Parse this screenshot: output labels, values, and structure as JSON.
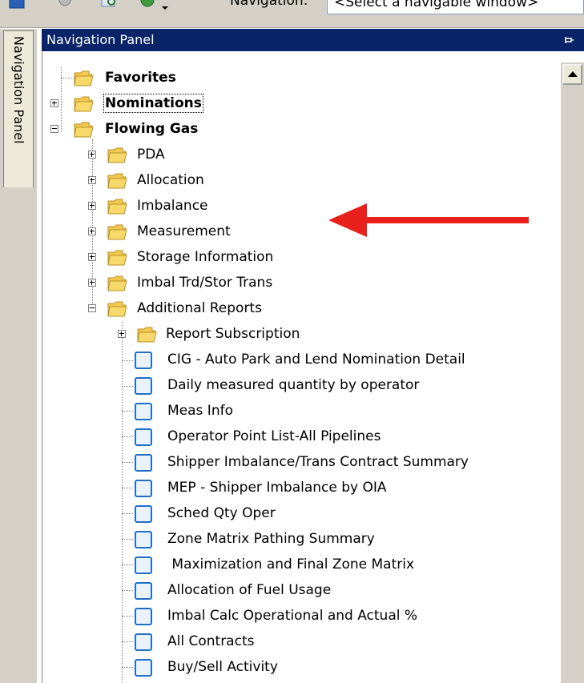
{
  "toolbar": {
    "navigation_label": "Navigation:",
    "window_select_value": "<Select a navigable window>"
  },
  "side_tab": {
    "label": "Navigation Panel"
  },
  "panel": {
    "title": "Navigation Panel"
  },
  "tree": {
    "root_items": [
      {
        "label": "Favorites"
      },
      {
        "label": "Nominations"
      },
      {
        "label": "Flowing Gas"
      }
    ],
    "flowing_gas_children": [
      {
        "label": "PDA"
      },
      {
        "label": "Allocation"
      },
      {
        "label": "Imbalance"
      },
      {
        "label": "Measurement"
      },
      {
        "label": "Storage Information"
      },
      {
        "label": "Imbal Trd/Stor Trans"
      },
      {
        "label": "Additional Reports"
      }
    ],
    "additional_reports": {
      "subfolder": "Report Subscription",
      "reports": [
        "CIG - Auto Park and Lend Nomination Detail",
        "Daily measured quantity by operator",
        "Meas Info",
        "Operator Point List-All Pipelines",
        "Shipper Imbalance/Trans Contract Summary",
        "MEP - Shipper Imbalance by OIA",
        "Sched Qty Oper",
        "Zone Matrix Pathing Summary",
        " Maximization and Final Zone Matrix",
        "Allocation of Fuel Usage",
        "Imbal Calc Operational and Actual %",
        "All Contracts",
        "Buy/Sell Activity"
      ]
    }
  },
  "colors": {
    "panel_header": "#0a246a",
    "annotation_arrow": "#e8211c",
    "folder": "#f2c94c",
    "report_icon_border": "#1f6fc5"
  }
}
